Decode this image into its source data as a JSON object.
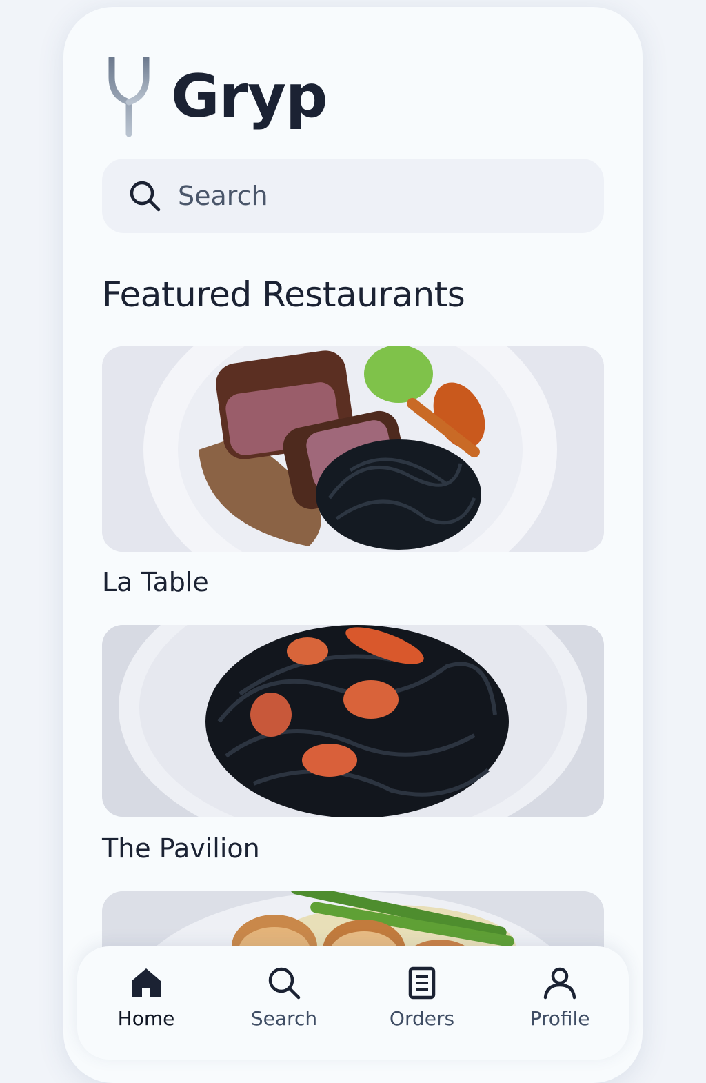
{
  "app": {
    "brand": "Gryp"
  },
  "search": {
    "placeholder": "Search"
  },
  "featured": {
    "title": "Featured Restaurants",
    "restaurants": [
      {
        "name": "La Table"
      },
      {
        "name": "The Pavilion"
      },
      {
        "name": ""
      }
    ]
  },
  "tabbar": {
    "items": [
      {
        "label": "Home",
        "icon": "home-icon",
        "active": true
      },
      {
        "label": "Search",
        "icon": "search-icon",
        "active": false
      },
      {
        "label": "Orders",
        "icon": "orders-icon",
        "active": false
      },
      {
        "label": "Profile",
        "icon": "profile-icon",
        "active": false
      }
    ]
  },
  "colors": {
    "text": "#1b2233",
    "accent": "#8f9aaa",
    "surface": "#f8fbfd",
    "search_bg": "#eef1f7"
  }
}
